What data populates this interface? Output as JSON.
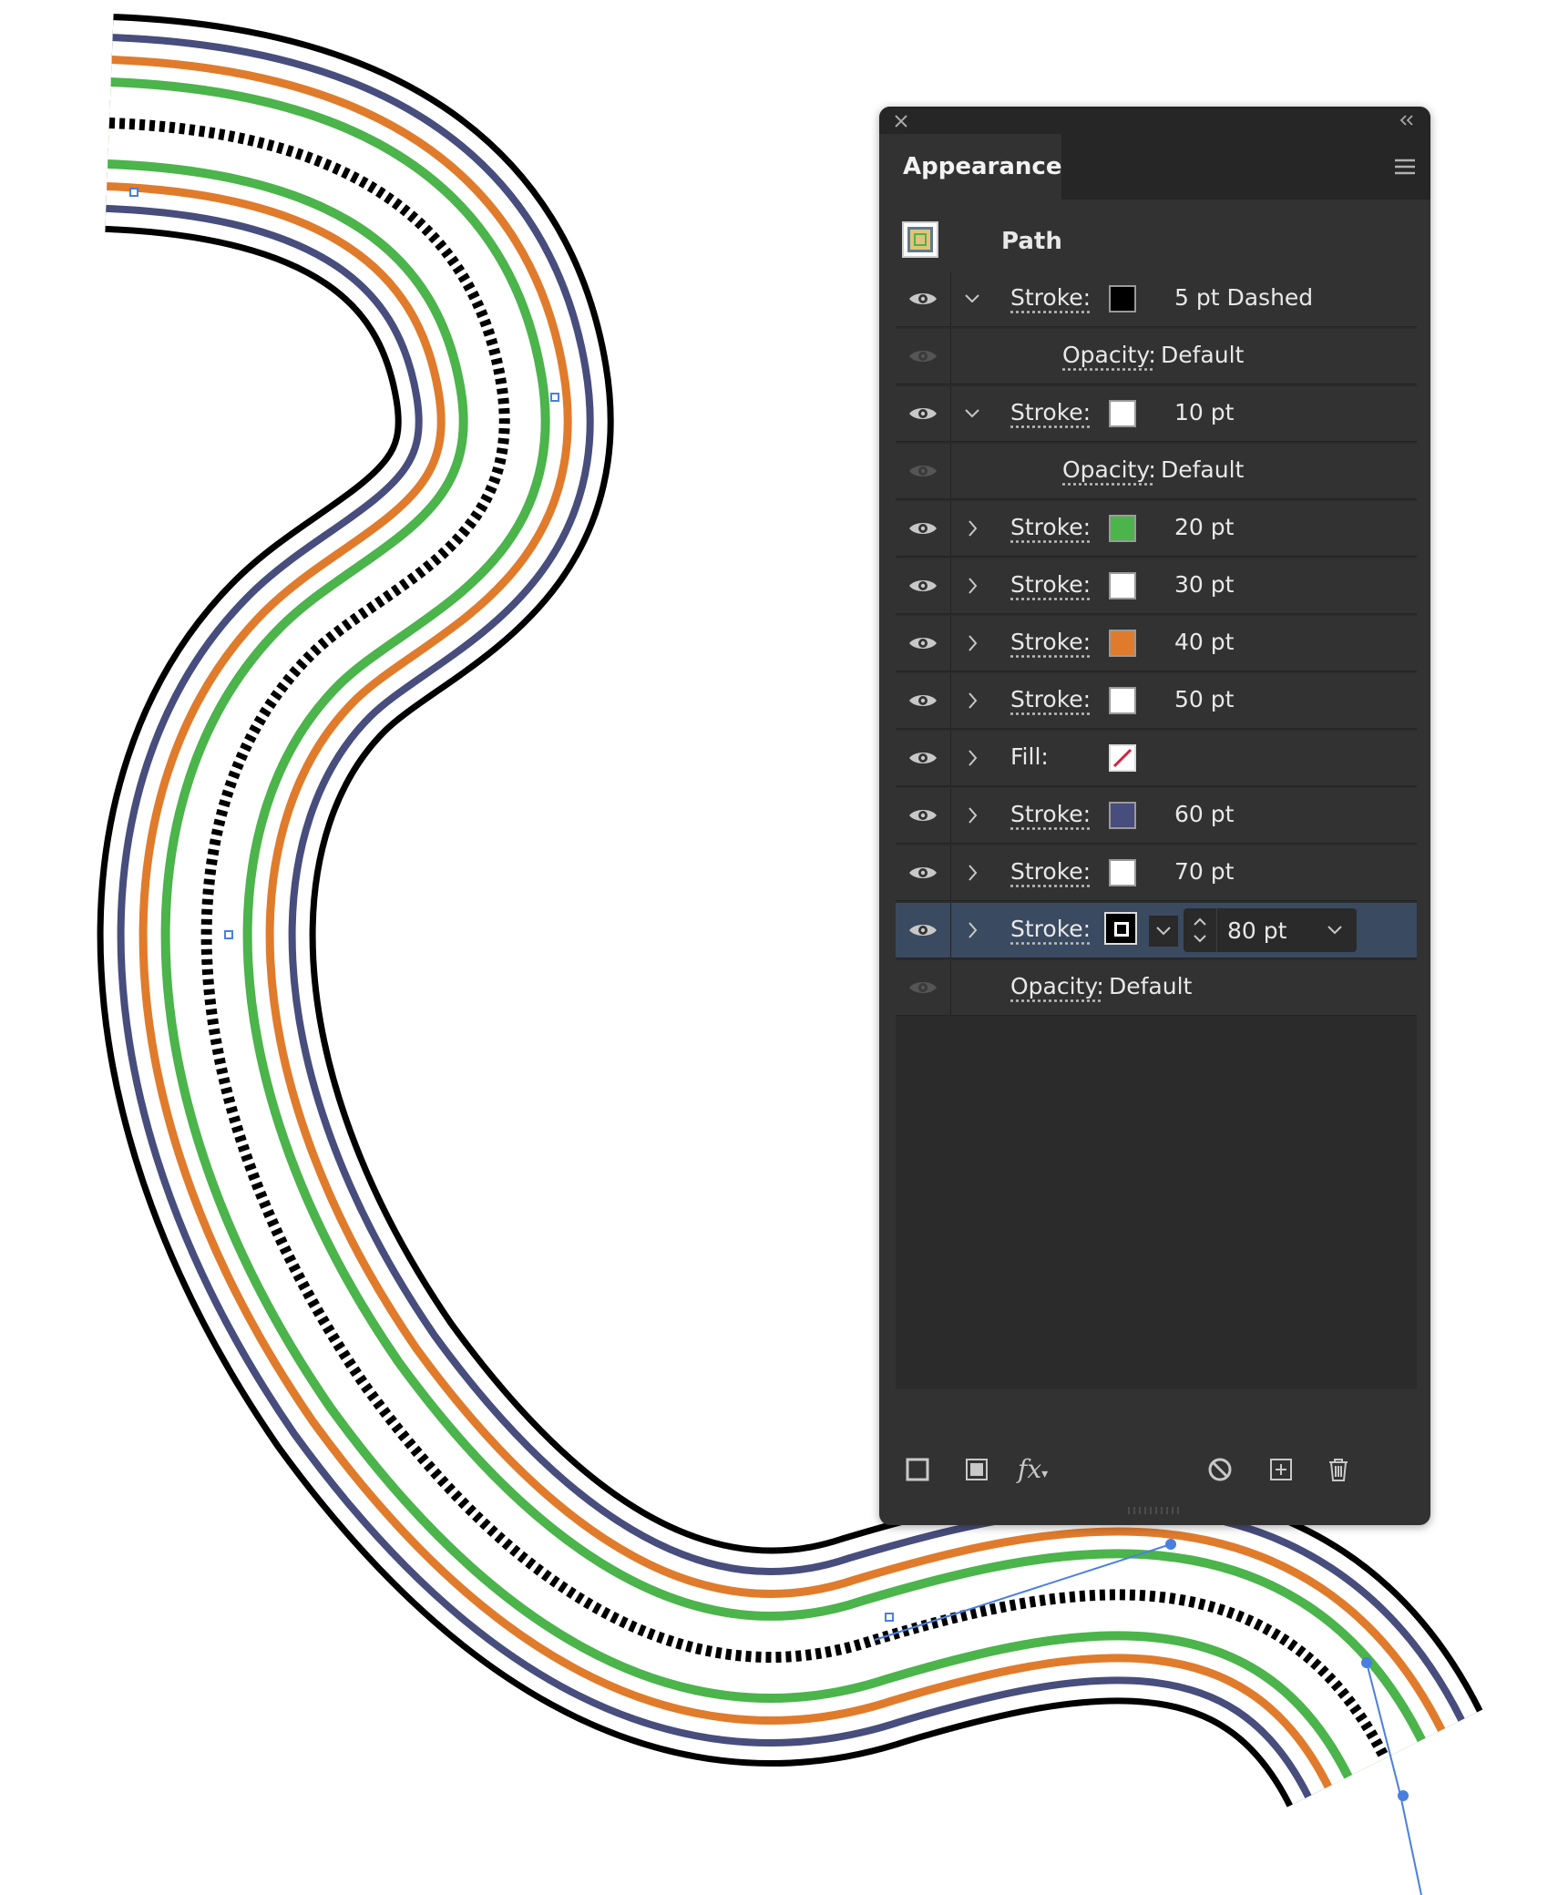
{
  "panel": {
    "tab_label": "Appearance",
    "header_label": "Path",
    "rows": [
      {
        "kind": "stroke",
        "label": "Stroke:",
        "swatch": "#000000",
        "value": "5 pt Dashed",
        "expanded": true
      },
      {
        "kind": "opacity",
        "label": "Opacity:",
        "value": "Default"
      },
      {
        "kind": "stroke",
        "label": "Stroke:",
        "swatch": "#ffffff",
        "value": "10 pt",
        "expanded": true
      },
      {
        "kind": "opacity",
        "label": "Opacity:",
        "value": "Default"
      },
      {
        "kind": "stroke",
        "label": "Stroke:",
        "swatch": "#4bb44b",
        "value": "20 pt"
      },
      {
        "kind": "stroke",
        "label": "Stroke:",
        "swatch": "#ffffff",
        "value": "30 pt"
      },
      {
        "kind": "stroke",
        "label": "Stroke:",
        "swatch": "#e07b2c",
        "value": "40 pt"
      },
      {
        "kind": "stroke",
        "label": "Stroke:",
        "swatch": "#ffffff",
        "value": "50 pt"
      },
      {
        "kind": "fill",
        "label": "Fill:",
        "swatch": "none"
      },
      {
        "kind": "stroke",
        "label": "Stroke:",
        "swatch": "#474d7c",
        "value": "60 pt"
      },
      {
        "kind": "stroke",
        "label": "Stroke:",
        "swatch": "#ffffff",
        "value": "70 pt"
      },
      {
        "kind": "stroke",
        "label": "Stroke:",
        "swatch": "#000000",
        "value": "80 pt",
        "selected": true
      },
      {
        "kind": "opacity",
        "label": "Opacity:",
        "value": "Default"
      }
    ],
    "bottom_icons": [
      "add-stroke-icon",
      "add-fill-icon",
      "fx-icon",
      "clear-appearance-icon",
      "duplicate-item-icon",
      "delete-item-icon"
    ],
    "fx_label": "fx"
  },
  "artwork": {
    "colors": {
      "black": "#000000",
      "navy": "#474d7c",
      "orange": "#e07b2c",
      "green": "#4bb44b",
      "white": "#ffffff",
      "anchor": "#4a7fe0"
    }
  }
}
